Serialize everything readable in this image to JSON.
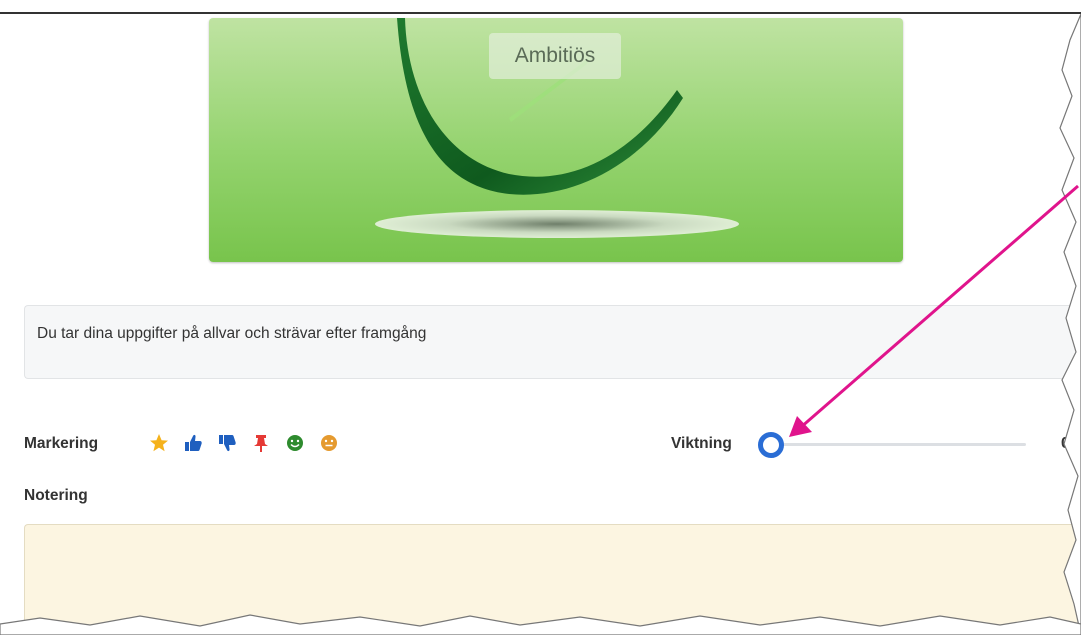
{
  "image_card": {
    "label": "Ambitiös"
  },
  "description": {
    "text": "Du tar dina uppgifter på allvar och strävar efter framgång"
  },
  "marking": {
    "label": "Markering",
    "icons": [
      {
        "name": "star-icon",
        "color": "#f5b21c"
      },
      {
        "name": "thumbs-up-icon",
        "color": "#1f5fbf"
      },
      {
        "name": "thumbs-down-icon",
        "color": "#1f5fbf"
      },
      {
        "name": "pin-icon",
        "color": "#e53935"
      },
      {
        "name": "smile-icon",
        "color": "#2e8b2e"
      },
      {
        "name": "neutral-face-icon",
        "color": "#e59a2f"
      }
    ]
  },
  "weighting": {
    "label": "Viktning",
    "value": "0"
  },
  "note": {
    "label": "Notering",
    "value": ""
  },
  "annotation": {
    "arrow_color": "#e0148c"
  }
}
